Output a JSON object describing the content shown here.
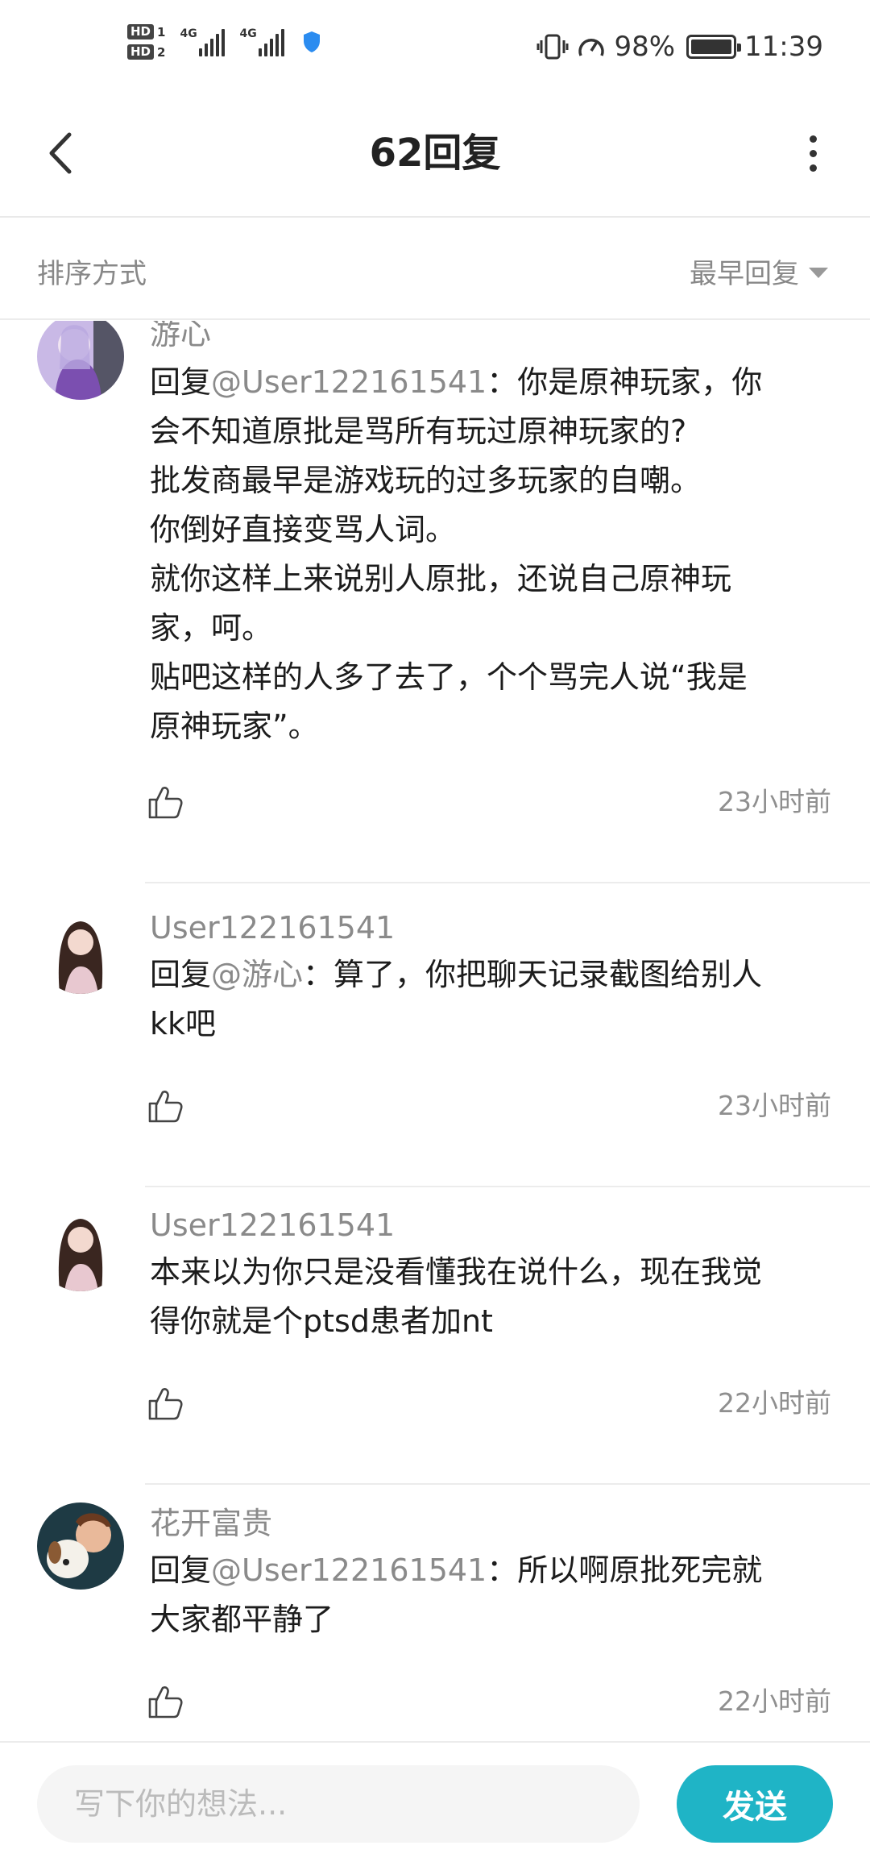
{
  "status_bar": {
    "hd1": "HD",
    "hd1_num": "1",
    "hd2": "HD",
    "hd2_num": "2",
    "net1": "4G",
    "net2": "4G",
    "battery_percent": "98%",
    "time": "11:39"
  },
  "header": {
    "title": "62回复"
  },
  "sort": {
    "label": "排序方式",
    "selected": "最早回复"
  },
  "comments": [
    {
      "author": "游心",
      "mention": "@User122161541",
      "text_prefix": "回复",
      "lines": [
        "：你是原神玩家，你",
        "会不知道原批是骂所有玩过原神玩家的?",
        "批发商最早是游戏玩的过多玩家的自嘲。",
        "你倒好直接变骂人词。",
        "就你这样上来说别人原批，还说自己原神玩",
        "家，呵。",
        "贴吧这样的人多了去了，个个骂完人说“我是",
        "原神玩家”。"
      ],
      "time": "23小时前",
      "avatar_color": "#9b84c9"
    },
    {
      "author": "User122161541",
      "mention": "@游心",
      "text_prefix": "回复",
      "lines": [
        "：算了，你把聊天记录截图给别人",
        "kk吧"
      ],
      "time": "23小时前",
      "avatar_color": "#3a2a2a"
    },
    {
      "author": "User122161541",
      "mention": "",
      "text_prefix": "",
      "lines": [
        "本来以为你只是没看懂我在说什么，现在我觉",
        "得你就是个ptsd患者加nt"
      ],
      "time": "22小时前",
      "avatar_color": "#3a2a2a"
    },
    {
      "author": "花开富贵",
      "mention": "@User122161541",
      "text_prefix": "回复",
      "lines": [
        "：所以啊原批死完就",
        "大家都平静了"
      ],
      "time": "22小时前",
      "avatar_color": "#2a4a55"
    }
  ],
  "input": {
    "placeholder": "写下你的想法..."
  },
  "send_label": "发送",
  "colors": {
    "accent": "#1fb4c6",
    "meta_text": "#8a8a8a"
  }
}
